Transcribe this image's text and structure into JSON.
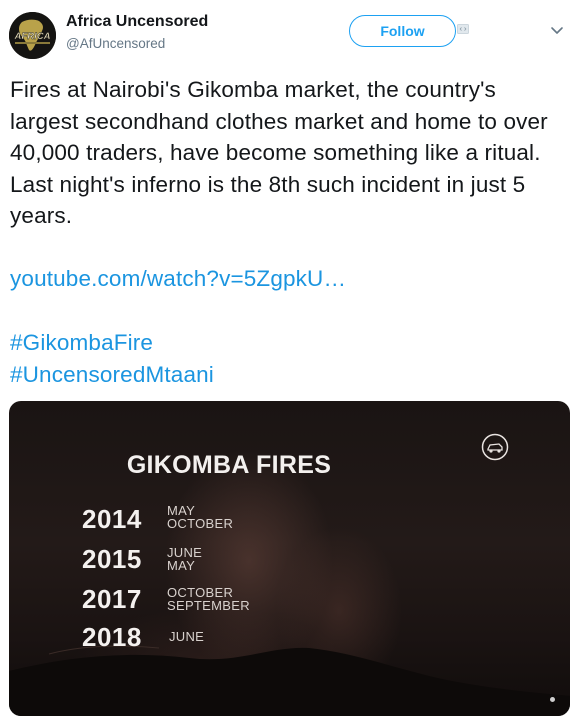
{
  "account": {
    "display_name": "Africa Uncensored",
    "handle": "@AfUncensored",
    "avatar_text": "AFRICA"
  },
  "actions": {
    "follow_label": "Follow",
    "caret_icon": "chevron-down-icon",
    "embed_icon": "embed-icon"
  },
  "tweet": {
    "text": "Fires at Nairobi's Gikomba market, the country's largest secondhand clothes market and home to over 40,000 traders, have become something like a ritual. Last night's inferno is the 8th such incident in just 5 years.",
    "link": "youtube.com/watch?v=5ZgpkU…",
    "hashtags": [
      "#GikombaFire",
      "#UncensoredMtaani"
    ]
  },
  "media": {
    "title": "GIKOMBA FIRES",
    "entries": [
      {
        "year": "2014",
        "months": [
          "MAY",
          "OCTOBER"
        ]
      },
      {
        "year": "2015",
        "months": [
          "JUNE",
          "MAY"
        ]
      },
      {
        "year": "2017",
        "months": [
          "OCTOBER",
          "SEPTEMBER"
        ]
      },
      {
        "year": "2018",
        "months": [
          "JUNE"
        ]
      }
    ]
  },
  "colors": {
    "link": "#1b95e0",
    "follow_border": "#1da1f2",
    "text": "#14171a",
    "muted": "#657786"
  }
}
